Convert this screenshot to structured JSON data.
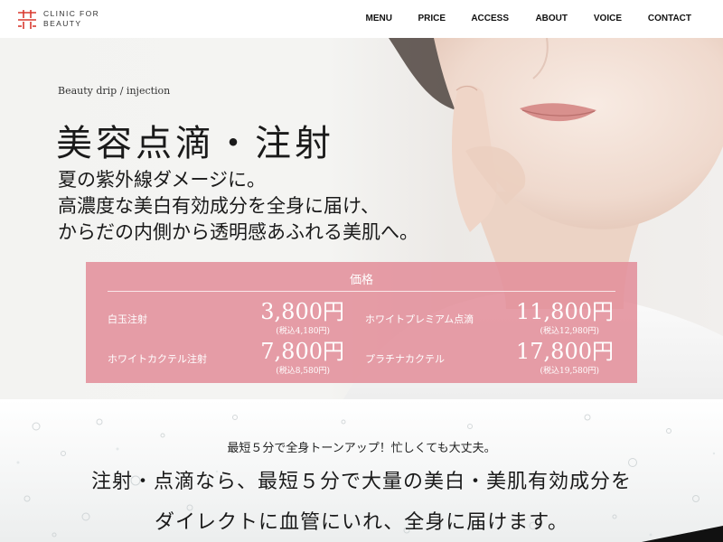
{
  "header": {
    "logo_line1": "CLINIC FOR",
    "logo_line2": "BEAUTY",
    "logo_color": "#d9382f",
    "nav": [
      {
        "label": "MENU",
        "name": "nav-menu"
      },
      {
        "label": "PRICE",
        "name": "nav-price"
      },
      {
        "label": "ACCESS",
        "name": "nav-access"
      },
      {
        "label": "ABOUT",
        "name": "nav-about"
      },
      {
        "label": "VOICE",
        "name": "nav-voice"
      },
      {
        "label": "CONTACT",
        "name": "nav-contact"
      }
    ]
  },
  "hero": {
    "subtitle": "Beauty drip / injection",
    "title": "美容点滴・注射",
    "lead": [
      "夏の紫外線ダメージに。",
      "高濃度な美白有効成分を全身に届け、",
      "からだの内側から透明感あふれる美肌へ。"
    ]
  },
  "price": {
    "heading": "価格",
    "accent_color": "#e28f9b",
    "items": [
      {
        "name": "白玉注射",
        "price": "3,800円",
        "tax": "(税込4,180円)"
      },
      {
        "name": "ホワイトプレミアム点滴",
        "price": "11,800円",
        "tax": "(税込12,980円)"
      },
      {
        "name": "ホワイトカクテル注射",
        "price": "7,800円",
        "tax": "(税込8,580円)"
      },
      {
        "name": "プラチナカクテル",
        "price": "17,800円",
        "tax": "(税込19,580円)"
      }
    ]
  },
  "lower": {
    "subtitle": "最短５分で全身トーンアップ！忙しくても大丈夫。",
    "line1": "注射・点滴なら、最短５分で大量の美白・美肌有効成分を",
    "line2": "ダイレクトに血管にいれ、全身に届けます。"
  }
}
